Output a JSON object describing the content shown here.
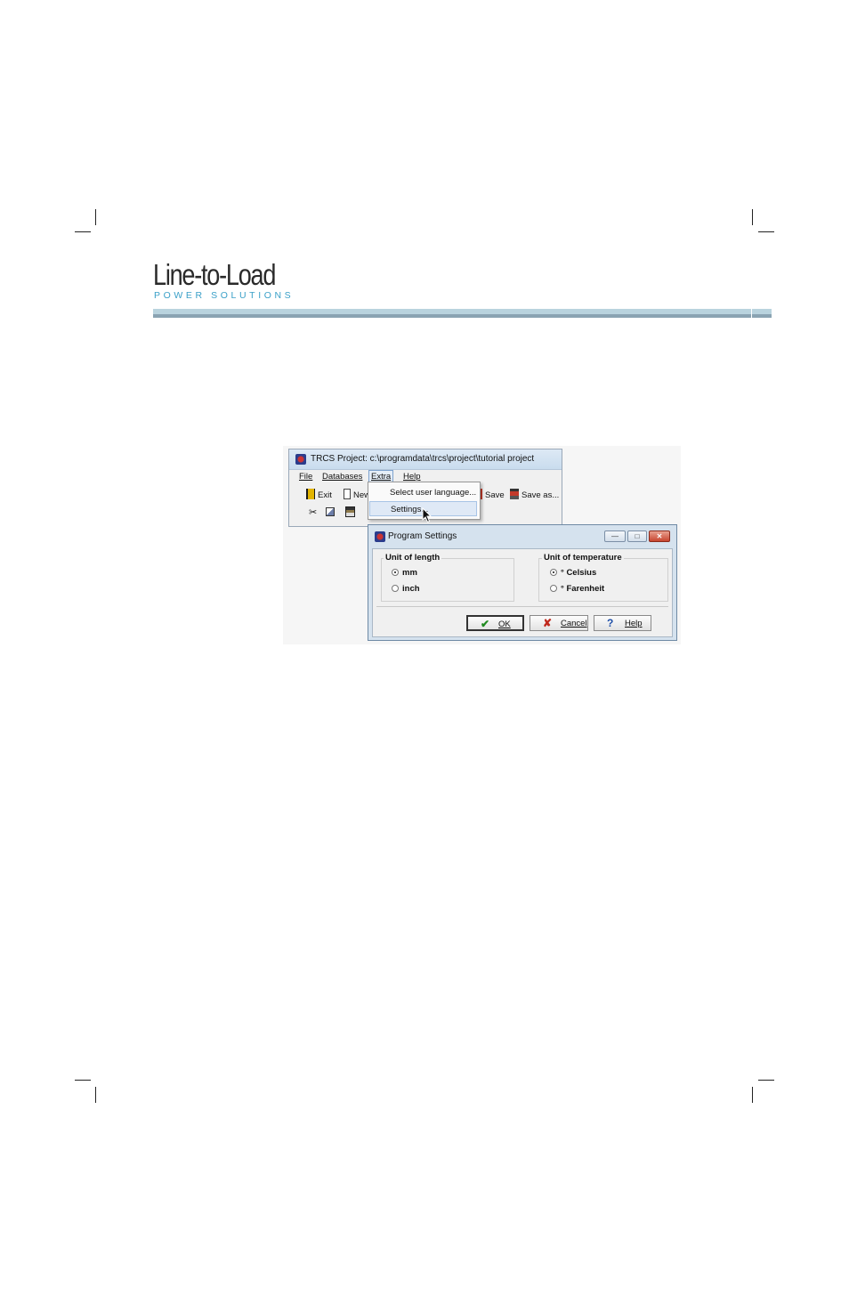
{
  "header": {
    "logo_title": "Line-to-Load",
    "logo_subtitle": "POWER SOLUTIONS",
    "colors": {
      "accent": "#3aa0c8",
      "bar_light": "#b9d3de",
      "bar_dark": "#8aa3b2"
    }
  },
  "main_window": {
    "title": "TRCS Project: c:\\programdata\\trcs\\project\\tutorial project",
    "menu": [
      "File",
      "Databases",
      "Extra",
      "Help"
    ],
    "active_menu": "Extra",
    "toolbar": {
      "exit": "Exit",
      "new": "New",
      "save": "Save",
      "save_as": "Save as..."
    }
  },
  "dropdown": {
    "items": [
      "Select user language...",
      "Settings..."
    ],
    "highlighted": "Settings..."
  },
  "dialog": {
    "title": "Program Settings",
    "length_group": {
      "label": "Unit of length",
      "options": [
        "mm",
        "inch"
      ],
      "selected": "mm"
    },
    "temperature_group": {
      "label": "Unit of temperature",
      "options": [
        "° Celsius",
        "° Farenheit"
      ],
      "selected": "° Celsius"
    },
    "buttons": {
      "ok": "OK",
      "cancel": "Cancel",
      "help": "Help"
    }
  }
}
